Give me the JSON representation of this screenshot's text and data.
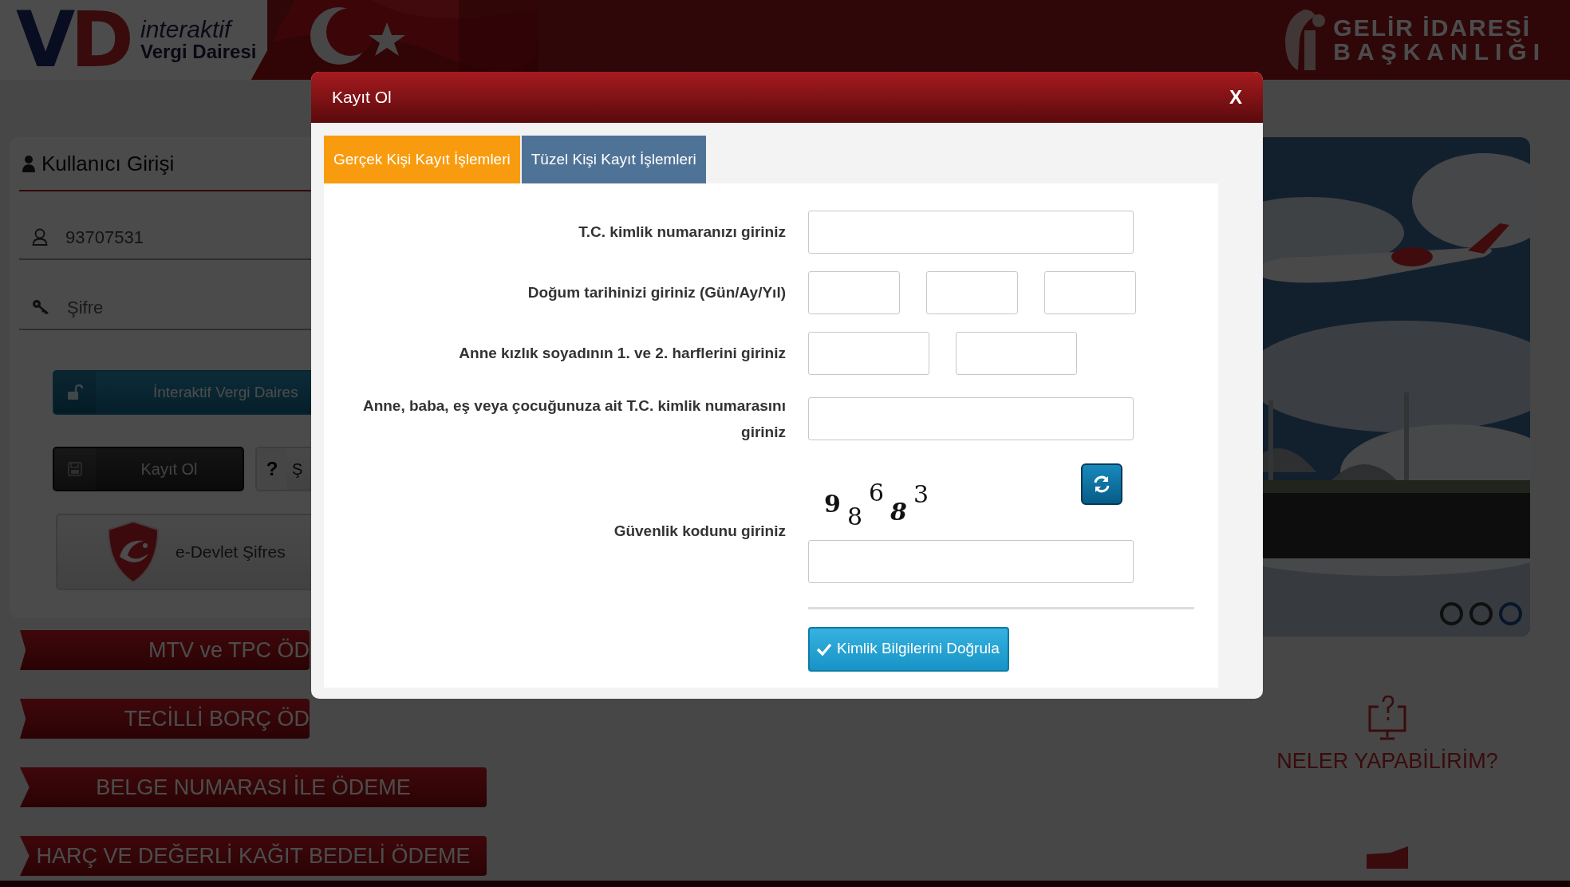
{
  "header": {
    "logo_letters": "VD",
    "brand_line1": "interaktif",
    "brand_line2": "Vergi Dairesi",
    "agency_line1": "GELİR İDARESİ",
    "agency_line2": "BAŞKANLIĞI"
  },
  "login": {
    "title": "Kullanıcı Girişi",
    "username": "93707531",
    "password_placeholder": "Şifre",
    "buttons": [
      {
        "kind": "login",
        "label": "İnteraktif Vergi Daires"
      },
      {
        "kind": "register",
        "label": "Kayıt Ol"
      },
      {
        "kind": "help",
        "icon_text": "?",
        "label": "Ş"
      },
      {
        "kind": "edevlet",
        "label": "e-Devlet Şifres"
      }
    ]
  },
  "menu": [
    {
      "label": "MTV ve TPC ÖD"
    },
    {
      "label": "TECİLLİ BORÇ ÖD"
    },
    {
      "label": "BELGE NUMARASI İLE ÖDEME"
    },
    {
      "label": "HARÇ VE DEĞERLİ KAĞIT BEDELİ ÖDEME"
    }
  ],
  "slider": {
    "dots": [
      {
        "selected": false
      },
      {
        "selected": false
      },
      {
        "selected": true
      }
    ]
  },
  "help_link": "NELER YAPABİLİRİM?",
  "modal": {
    "title": "Kayıt Ol",
    "close": "X",
    "tabs": [
      {
        "label": "Gerçek Kişi Kayıt İşlemleri",
        "selected": true
      },
      {
        "label": "Tüzel Kişi Kayıt İşlemleri",
        "selected": false
      }
    ],
    "fields": [
      {
        "kind": "single",
        "label": "T.C. kimlik numaranızı giriniz"
      },
      {
        "kind": "date",
        "label": "Doğum tarihinizi giriniz (Gün/Ay/Yıl)"
      },
      {
        "kind": "pair",
        "label": "Anne kızlık soyadının 1. ve 2. harflerini giriniz"
      },
      {
        "kind": "single",
        "label": "Anne, baba, eş veya çocuğunuza ait T.C. kimlik numarasını giriniz"
      },
      {
        "kind": "captcha",
        "label": "Güvenlik kodunu giriniz",
        "digits": [
          "9",
          "8",
          "6",
          "8",
          "3"
        ]
      }
    ],
    "submit": "Kimlik Bilgilerini Doğrula"
  }
}
